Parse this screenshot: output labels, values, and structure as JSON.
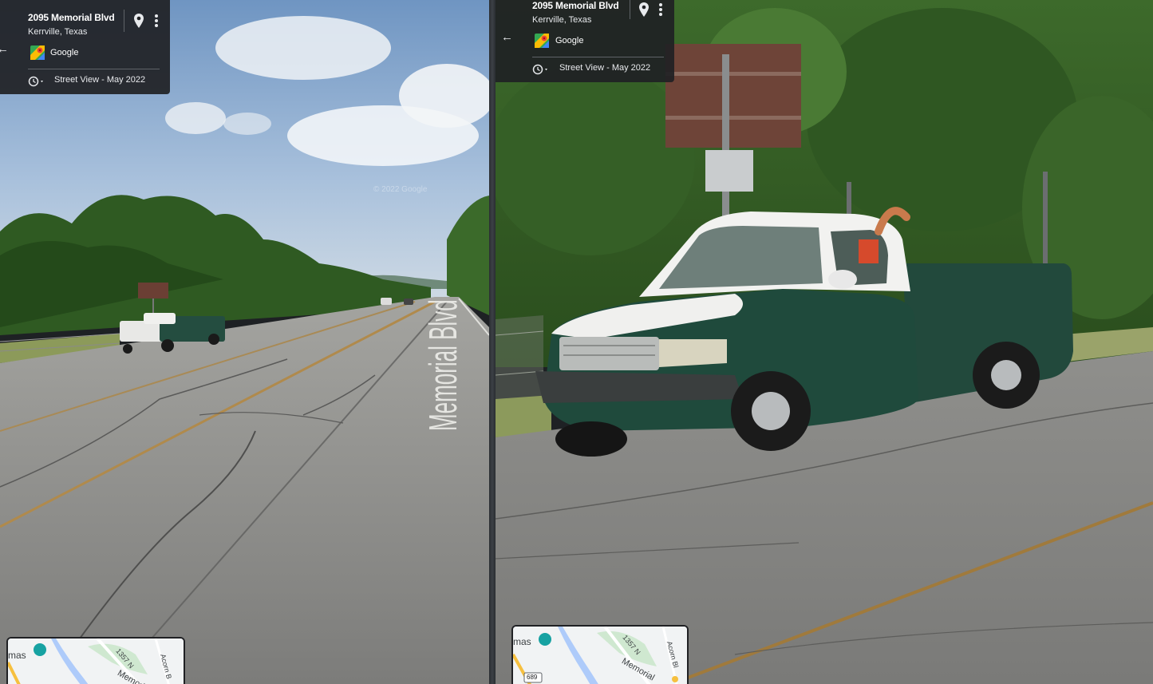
{
  "left_panel": {
    "card": {
      "address": "2095 Memorial Blvd",
      "locality": "Kerrville, Texas",
      "provider": "Google",
      "capture": "Street View - May 2022",
      "back_icon": "back-arrow-icon",
      "pin_icon": "pin-icon",
      "menu_icon": "more-vert-icon",
      "history_icon": "history-clock-icon"
    },
    "road_marking": "Memorial Blvd",
    "watermark": "© 2022 Google",
    "minimap": {
      "poi_label": "mas",
      "road_route": "1357 N",
      "road_name": "Memorial",
      "road_street": "Acorn B"
    }
  },
  "right_panel": {
    "card": {
      "address": "2095 Memorial Blvd",
      "locality": "Kerrville, Texas",
      "provider": "Google",
      "capture": "Street View - May 2022",
      "back_icon": "back-arrow-icon",
      "pin_icon": "pin-icon",
      "menu_icon": "more-vert-icon",
      "history_icon": "history-clock-icon"
    },
    "minimap": {
      "poi_label": "mas",
      "road_route": "1357 N",
      "road_name": "Memorial",
      "road_street": "Acorn Bl",
      "highway_shield": "689"
    }
  },
  "colors": {
    "card_bg": "#202124",
    "truck_body": "#1f4a3c",
    "truck_cab_roof": "#f2f2f0",
    "sky": "#8fb0cf",
    "asphalt": "#8a8a88",
    "foliage": "#2f5a22",
    "map_water": "#aecbfa",
    "map_poi": "#17a2a2"
  }
}
